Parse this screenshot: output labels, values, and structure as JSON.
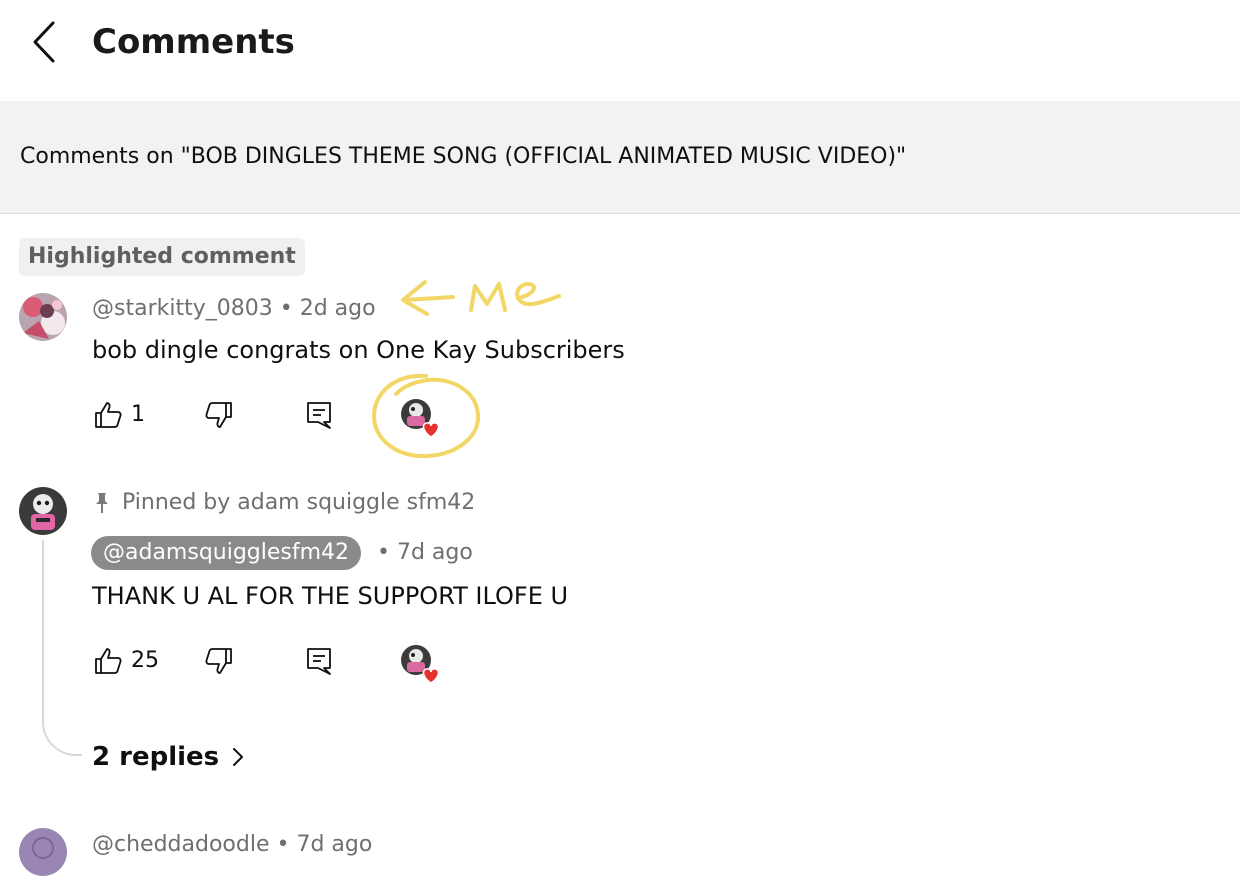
{
  "header": {
    "title": "Comments"
  },
  "banner": {
    "text": "Comments on \"BOB DINGLES THEME SONG (OFFICIAL ANIMATED MUSIC VIDEO)\""
  },
  "highlighted_label": "Highlighted comment",
  "comments": [
    {
      "author": "@starkitty_0803",
      "time": "• 2d ago",
      "text": "bob dingle congrats on One Kay Subscribers",
      "likes": "1",
      "annotation": "<- me"
    },
    {
      "pinned": "Pinned by adam squiggle sfm42",
      "author": "@adamsquigglesfm42",
      "time": "• 7d ago",
      "text": "THANK U AL FOR THE SUPPORT ILOFE U",
      "likes": "25",
      "replies": "2 replies"
    },
    {
      "author": "@cheddadoodle",
      "time": "• 7d ago"
    }
  ],
  "colors": {
    "annotation": "#f2d766",
    "heart": "#e5322d",
    "chip_bg": "#8a8a8a"
  }
}
